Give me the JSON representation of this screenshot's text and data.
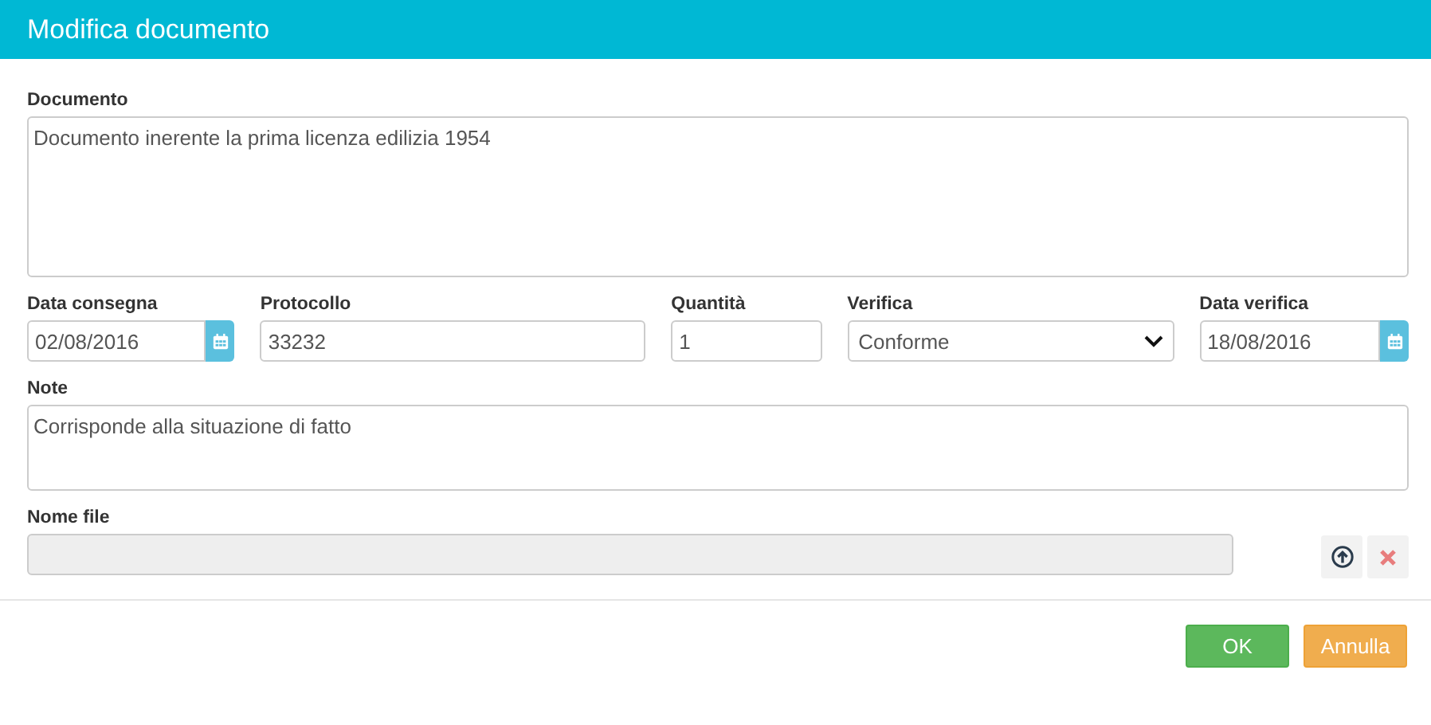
{
  "window": {
    "title": "Modifica documento"
  },
  "document": {
    "label": "Documento",
    "value": "Documento inerente la prima licenza edilizia 1954"
  },
  "row": [
    {
      "kind": "date",
      "label": "Data consegna",
      "value": "02/08/2016"
    },
    {
      "kind": "text",
      "label": "Protocollo",
      "value": "33232"
    },
    {
      "kind": "text",
      "label": "Quantità",
      "value": "1"
    },
    {
      "kind": "select",
      "label": "Verifica",
      "value": "Conforme"
    },
    {
      "kind": "date",
      "label": "Data verifica",
      "value": "18/08/2016"
    }
  ],
  "note": {
    "label": "Note",
    "value": "Corrisponde alla situazione di fatto"
  },
  "file": {
    "label": "Nome file",
    "disabled": true
  },
  "buttons": [
    {
      "kind": "confirm",
      "label": "OK"
    },
    {
      "kind": "cancel",
      "label": "Annulla"
    }
  ]
}
